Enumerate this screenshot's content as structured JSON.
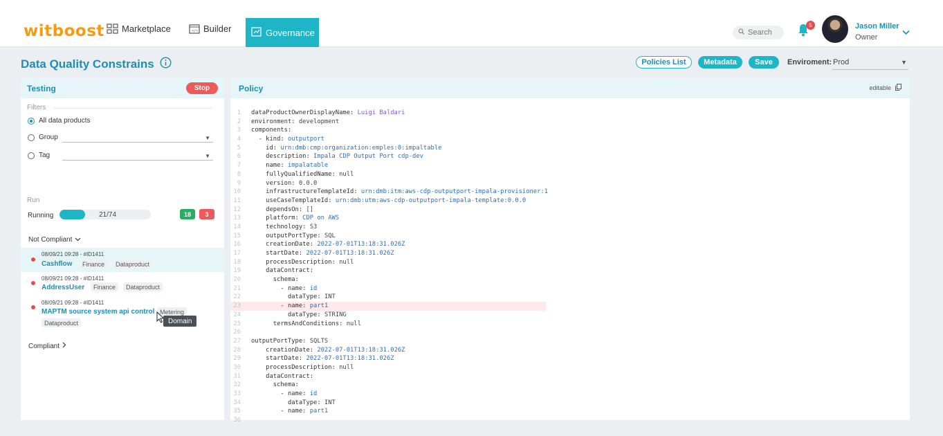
{
  "header": {
    "logo": "witboost",
    "nav": [
      {
        "label": "Marketplace"
      },
      {
        "label": "Builder"
      },
      {
        "label": "Governance"
      }
    ],
    "search_placeholder": "Search",
    "notification_count": "5",
    "user": {
      "name": "Jason Miller",
      "role": "Owner"
    }
  },
  "page": {
    "title": "Data Quality Constrains",
    "buttons": {
      "policies": "Policies List",
      "metadata": "Metadata",
      "save": "Save"
    },
    "environment": {
      "label": "Enviroment:",
      "value": "Prod"
    }
  },
  "testing": {
    "title": "Testing",
    "stop": "Stop",
    "filters_label": "Filters",
    "filters": [
      {
        "label": "All data products",
        "checked": true
      },
      {
        "label": "Group",
        "checked": false
      },
      {
        "label": "Tag",
        "checked": false
      }
    ],
    "run_label": "Run",
    "running_label": "Running",
    "progress_text": "21/74",
    "progress_fraction": 0.2838,
    "passed_count": "18",
    "failed_count": "3",
    "not_compliant_label": "Not Compliant",
    "compliant_label": "Compliant",
    "items": [
      {
        "meta": "08/09/21 09:28 - #ID1411",
        "name": "Cashflow",
        "tags": [
          "Finance",
          "Dataproduct"
        ]
      },
      {
        "meta": "08/09/21 09:28 - #ID1411",
        "name": "AddressUser",
        "tags": [
          "Finance",
          "Dataproduct"
        ]
      },
      {
        "meta": "08/09/21 09:28 - #ID1411",
        "name": "MAPTM source system api control",
        "tags": [
          "Metering",
          "Dataproduct"
        ]
      }
    ],
    "tooltip": "Domain"
  },
  "policy": {
    "title": "Policy",
    "editable_label": "editable",
    "line_numbers": [
      "1",
      "2",
      "3",
      "4",
      "5",
      "6",
      "7",
      "8",
      "9",
      "10",
      "11",
      "12",
      "13",
      "14",
      "15",
      "16",
      "17",
      "18",
      "19",
      "20",
      "21",
      "22",
      "23",
      "24",
      "25",
      "26",
      "27",
      "28",
      "29",
      "30",
      "31",
      "32",
      "33",
      "34",
      "35",
      "36"
    ],
    "lines": [
      [
        "dataProductOwnerDisplayName: ",
        "Luigi Baldari"
      ],
      [
        "environment: ",
        "development"
      ],
      [
        "components:",
        ""
      ],
      [
        "  - kind: ",
        "outputport"
      ],
      [
        "    id: ",
        "urn:dmb:cmp:organization:emples:0:impaltable"
      ],
      [
        "    description: ",
        "Impala CDP Output Port cdp-dev"
      ],
      [
        "    name: ",
        "impalatable"
      ],
      [
        "    fullyQualifiedName: ",
        "null"
      ],
      [
        "    version: ",
        "0.0.0"
      ],
      [
        "    infrastructureTemplateId: ",
        "urn:dmb:itm:aws-cdp-outputport-impala-provisioner:1"
      ],
      [
        "    useCaseTemplateId: ",
        "urn:dmb:utm:aws-cdp-outputport-impala-template:0.0.0"
      ],
      [
        "    dependsOn: ",
        "[]"
      ],
      [
        "    platform: ",
        "CDP on AWS"
      ],
      [
        "    technology: ",
        "S3"
      ],
      [
        "    outputPortType: ",
        "SQL"
      ],
      [
        "    creationDate: ",
        "2022-07-01T13:18:31.026Z"
      ],
      [
        "    startDate: ",
        "2022-07-01T13:18:31.026Z"
      ],
      [
        "    processDescription: ",
        "null"
      ],
      [
        "    dataContract:",
        ""
      ],
      [
        "      schema:",
        ""
      ],
      [
        "        - name: ",
        "id"
      ],
      [
        "          dataType: ",
        "INT"
      ],
      [
        "        - name: ",
        "part1"
      ],
      [
        "          dataType: ",
        "STRING"
      ],
      [
        "      termsAndConditions: ",
        "null"
      ],
      [
        "",
        ""
      ],
      [
        "outputPortType: ",
        "SQLTS"
      ],
      [
        "    creationDate: ",
        "2022-07-01T13:18:31.026Z"
      ],
      [
        "    startDate: ",
        "2022-07-01T13:18:31.026Z"
      ],
      [
        "    processDescription: ",
        "null"
      ],
      [
        "    dataContract:",
        ""
      ],
      [
        "      schema:",
        ""
      ],
      [
        "        - name: ",
        "id"
      ],
      [
        "          dataType: ",
        "INT"
      ],
      [
        "        - name: ",
        "part1"
      ],
      [
        "",
        ""
      ]
    ],
    "error_line": 23
  }
}
